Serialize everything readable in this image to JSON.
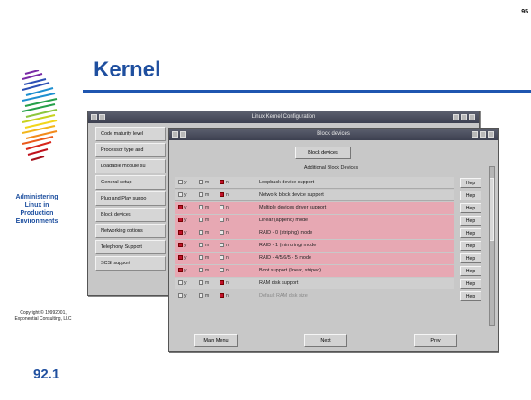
{
  "slide": {
    "page_number": "95",
    "title": "Kernel",
    "left_title": [
      "Administering",
      "Linux in",
      "Production",
      "Environments"
    ],
    "copyright": [
      "Copyright © 19992001,",
      "Exponential Consulting, LLC"
    ],
    "slide_number": "92.1"
  },
  "back_window": {
    "title": "Linux Kernel Configuration",
    "menu_items": [
      "Code maturity level",
      "Processor type and",
      "Loadable module su",
      "General setup",
      "Plug and Play suppo",
      "Block devices",
      "Networking options",
      "Telephony Support",
      "SCSI support"
    ]
  },
  "front_window": {
    "title": "Block devices",
    "block_devices_button": "Block devices",
    "section_title": "Additional Block Devices",
    "options": [
      "y",
      "m",
      "n"
    ],
    "rows": [
      {
        "label": "Loopback device support",
        "style": "grey",
        "sel": "n"
      },
      {
        "label": "Network block device support",
        "style": "grey",
        "sel": "n"
      },
      {
        "label": "Multiple devices driver support",
        "style": "pink",
        "sel": "y"
      },
      {
        "label": "Linear (append) mode",
        "style": "pink",
        "sel": "y"
      },
      {
        "label": "RAID - 0 (striping) mode",
        "style": "pink",
        "sel": "y"
      },
      {
        "label": "RAID - 1 (mirroring) mode",
        "style": "pink",
        "sel": "y"
      },
      {
        "label": "RAID - 4/5/6/5 - 5 mode",
        "style": "pink",
        "sel": "y"
      },
      {
        "label": "Boot support (linear, striped)",
        "style": "pink",
        "sel": "y"
      },
      {
        "label": "RAM disk support",
        "style": "grey",
        "sel": "n"
      },
      {
        "label": "Default RAM disk size",
        "style": "dim",
        "sel": "n"
      }
    ],
    "help_label": "Help",
    "buttons": [
      "Main Menu",
      "Next",
      "Prev"
    ]
  },
  "colors": {
    "accent_blue": "#1f4f9f",
    "selected_row": "#e7a8b3",
    "selected_mark": "#c0102a"
  }
}
